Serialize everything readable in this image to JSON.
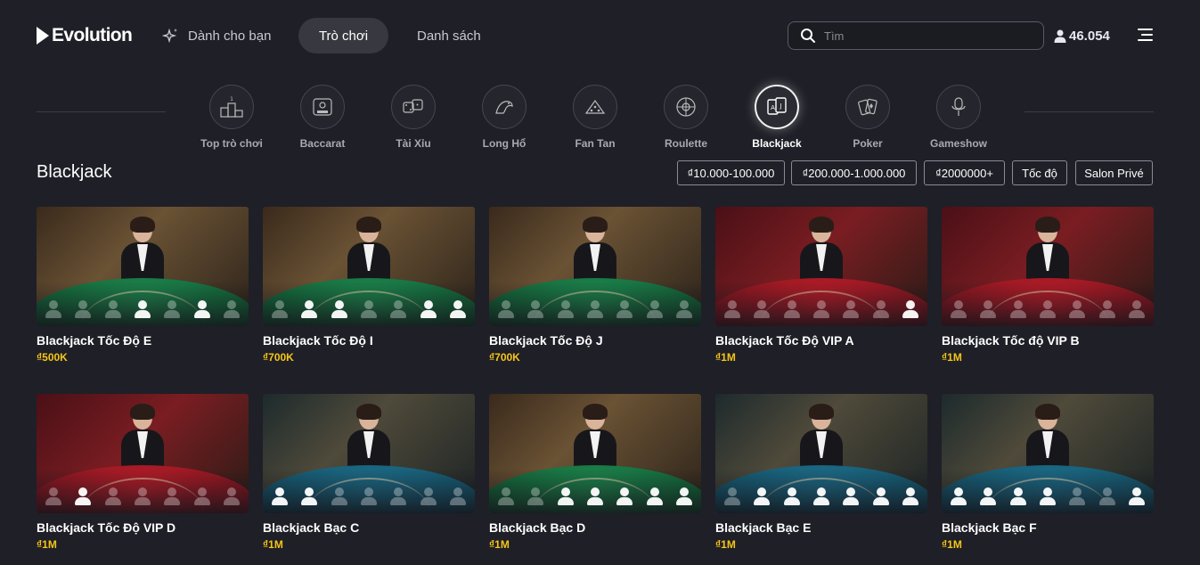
{
  "header": {
    "logo_text": "Evolution",
    "nav": {
      "for_you": "Dành cho bạn",
      "games": "Trò chơi",
      "list": "Danh sách"
    },
    "search_placeholder": "Tìm",
    "balance": "46.054"
  },
  "categories": [
    {
      "label": "Top trò chơi",
      "icon": "podium-icon"
    },
    {
      "label": "Baccarat",
      "icon": "baccarat-icon"
    },
    {
      "label": "Tài Xỉu",
      "icon": "dice-icon"
    },
    {
      "label": "Long Hổ",
      "icon": "dragon-tiger-icon"
    },
    {
      "label": "Fan Tan",
      "icon": "fan-tan-icon"
    },
    {
      "label": "Roulette",
      "icon": "roulette-icon"
    },
    {
      "label": "Blackjack",
      "icon": "cards-icon",
      "active": true
    },
    {
      "label": "Poker",
      "icon": "poker-cards-icon"
    },
    {
      "label": "Gameshow",
      "icon": "microphone-icon"
    }
  ],
  "section": {
    "title": "Blackjack"
  },
  "filters": [
    "₫10.000-100.000",
    "₫200.000-1.000.000",
    "₫2000000+",
    "Tốc độ",
    "Salon Privé"
  ],
  "games": [
    {
      "name": "Blackjack Tốc Độ E",
      "limit": "₫500K",
      "felt": "green",
      "seats": [
        0,
        0,
        0,
        1,
        0,
        1,
        0
      ]
    },
    {
      "name": "Blackjack Tốc Độ I",
      "limit": "₫700K",
      "felt": "green",
      "seats": [
        0,
        1,
        1,
        0,
        0,
        1,
        1
      ]
    },
    {
      "name": "Blackjack Tốc Độ J",
      "limit": "₫700K",
      "felt": "green",
      "seats": [
        0,
        0,
        0,
        0,
        0,
        0,
        0
      ]
    },
    {
      "name": "Blackjack Tốc Độ VIP A",
      "limit": "₫1M",
      "felt": "red",
      "seats": [
        0,
        0,
        0,
        0,
        0,
        0,
        1
      ]
    },
    {
      "name": "Blackjack Tốc độ VIP B",
      "limit": "₫1M",
      "felt": "red",
      "seats": [
        0,
        0,
        0,
        0,
        0,
        0,
        0
      ]
    },
    {
      "name": "Blackjack Tốc Độ VIP D",
      "limit": "₫1M",
      "felt": "red",
      "seats": [
        0,
        1,
        0,
        0,
        0,
        0,
        0
      ]
    },
    {
      "name": "Blackjack Bạc C",
      "limit": "₫1M",
      "felt": "teal",
      "seats": [
        1,
        1,
        0,
        0,
        0,
        0,
        0
      ]
    },
    {
      "name": "Blackjack Bạc D",
      "limit": "₫1M",
      "felt": "green",
      "seats": [
        0,
        0,
        1,
        1,
        1,
        1,
        1
      ]
    },
    {
      "name": "Blackjack Bạc E",
      "limit": "₫1M",
      "felt": "teal",
      "seats": [
        0,
        1,
        1,
        1,
        1,
        1,
        1
      ]
    },
    {
      "name": "Blackjack Bạc F",
      "limit": "₫1M",
      "felt": "teal",
      "seats": [
        1,
        1,
        1,
        1,
        0,
        0,
        1
      ]
    }
  ],
  "colors": {
    "background": "#1f1f27",
    "accent_limit": "#f5c518",
    "active_pill": "#383840"
  }
}
